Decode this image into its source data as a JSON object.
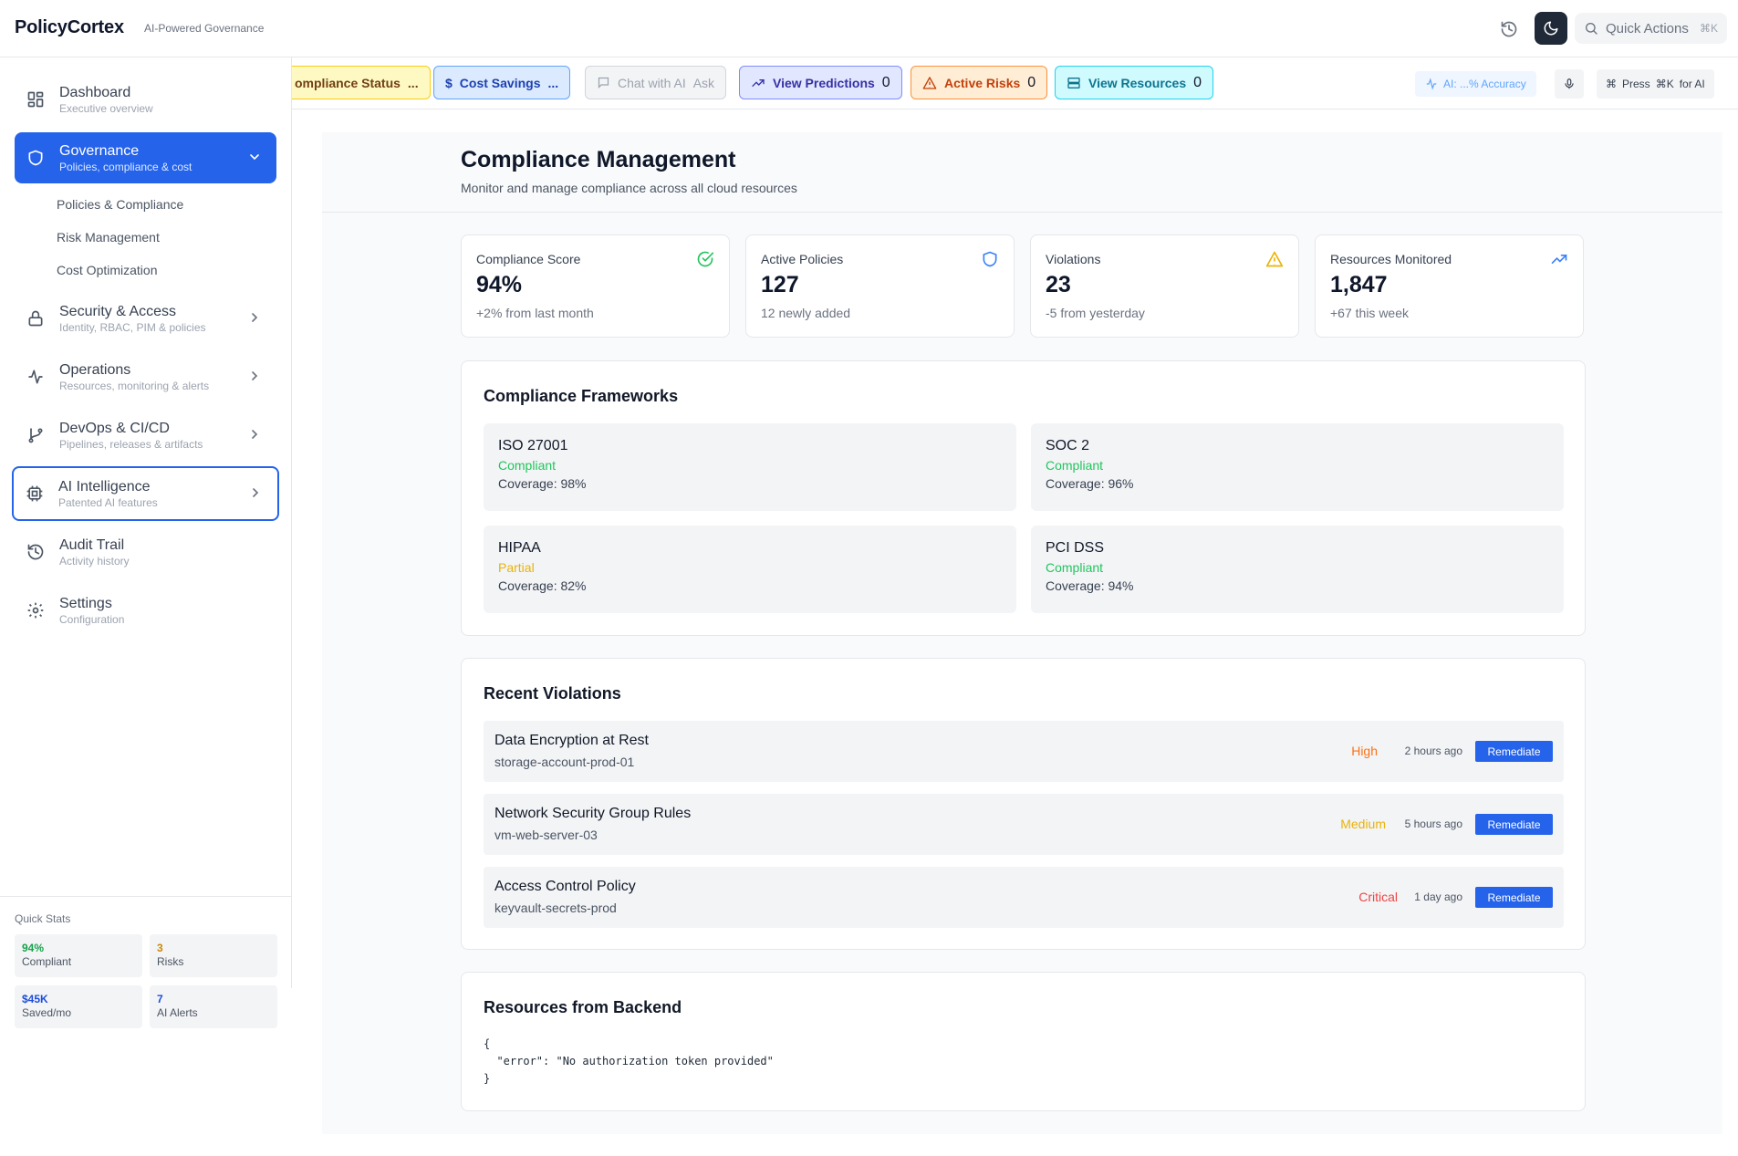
{
  "header": {
    "brand": "PolicyCortex",
    "tagline": "AI-Powered Governance",
    "quick_actions": "Quick Actions",
    "quick_shortcut": "⌘K"
  },
  "sidebar": {
    "items": [
      {
        "label": "Dashboard",
        "sub": "Executive overview",
        "icon": "grid-icon"
      },
      {
        "label": "Governance",
        "sub": "Policies, compliance & cost",
        "icon": "shield-icon"
      },
      {
        "label": "Security & Access",
        "sub": "Identity, RBAC, PIM & policies",
        "icon": "lock-icon"
      },
      {
        "label": "Operations",
        "sub": "Resources, monitoring & alerts",
        "icon": "activity-icon"
      },
      {
        "label": "DevOps & CI/CD",
        "sub": "Pipelines, releases & artifacts",
        "icon": "git-branch-icon"
      },
      {
        "label": "AI Intelligence",
        "sub": "Patented AI features",
        "icon": "cpu-icon"
      },
      {
        "label": "Audit Trail",
        "sub": "Activity history",
        "icon": "history-icon"
      },
      {
        "label": "Settings",
        "sub": "Configuration",
        "icon": "gear-icon"
      }
    ],
    "governance_sub": [
      "Policies & Compliance",
      "Risk Management",
      "Cost Optimization"
    ],
    "quick_stats": {
      "title": "Quick Stats",
      "cards": [
        {
          "value": "94%",
          "label": "Compliant",
          "color": "#16a34a"
        },
        {
          "value": "3",
          "label": "Risks",
          "color": "#ca8a04"
        },
        {
          "value": "$45K",
          "label": "Saved/mo",
          "color": "#1d4ed8"
        },
        {
          "value": "7",
          "label": "AI Alerts",
          "color": "#1d4ed8"
        }
      ]
    }
  },
  "actionbar": {
    "pills": [
      {
        "label": "ompliance Status",
        "suffix": "...",
        "style": "yellow"
      },
      {
        "label": "Cost Savings",
        "suffix": "...",
        "style": "blue"
      },
      {
        "label": "Chat with AI",
        "suffix": "Ask",
        "style": "gray"
      },
      {
        "label": "View Predictions",
        "count": "0",
        "style": "indigo"
      },
      {
        "label": "Active Risks",
        "count": "0",
        "style": "orange"
      },
      {
        "label": "View Resources",
        "count": "0",
        "style": "cyan"
      }
    ],
    "accuracy": "AI: ...% Accuracy",
    "press_hint": {
      "press": "Press",
      "key": "⌘K",
      "suffix": "for AI"
    }
  },
  "page": {
    "title": "Compliance Management",
    "subtitle": "Monitor and manage compliance across all cloud resources"
  },
  "stats": [
    {
      "title": "Compliance Score",
      "value": "94%",
      "change": "+2% from last month",
      "icon": "check-circle-icon"
    },
    {
      "title": "Active Policies",
      "value": "127",
      "change": "12 newly added",
      "icon": "shield-icon"
    },
    {
      "title": "Violations",
      "value": "23",
      "change": "-5 from yesterday",
      "icon": "warning-icon"
    },
    {
      "title": "Resources Monitored",
      "value": "1,847",
      "change": "+67 this week",
      "icon": "trending-up-icon"
    }
  ],
  "frameworks": {
    "title": "Compliance Frameworks",
    "items": [
      {
        "name": "ISO 27001",
        "status": "Compliant",
        "coverage": "Coverage: 98%"
      },
      {
        "name": "SOC 2",
        "status": "Compliant",
        "coverage": "Coverage: 96%"
      },
      {
        "name": "HIPAA",
        "status": "Partial",
        "coverage": "Coverage: 82%"
      },
      {
        "name": "PCI DSS",
        "status": "Compliant",
        "coverage": "Coverage: 94%"
      }
    ]
  },
  "violations": {
    "title": "Recent Violations",
    "items": [
      {
        "name": "Data Encryption at Rest",
        "resource": "storage-account-prod-01",
        "severity": "High",
        "time": "2 hours ago",
        "action": "Remediate"
      },
      {
        "name": "Network Security Group Rules",
        "resource": "vm-web-server-03",
        "severity": "Medium",
        "time": "5 hours ago",
        "action": "Remediate"
      },
      {
        "name": "Access Control Policy",
        "resource": "keyvault-secrets-prod",
        "severity": "Critical",
        "time": "1 day ago",
        "action": "Remediate"
      }
    ]
  },
  "backend": {
    "title": "Resources from Backend",
    "json": "{\n  \"error\": \"No authorization token provided\"\n}"
  },
  "colors": {
    "accent": "#2563eb",
    "compliant": "#22c55e",
    "partial": "#eab308",
    "high": "#f97316",
    "medium": "#eab308",
    "critical": "#ef4444"
  }
}
